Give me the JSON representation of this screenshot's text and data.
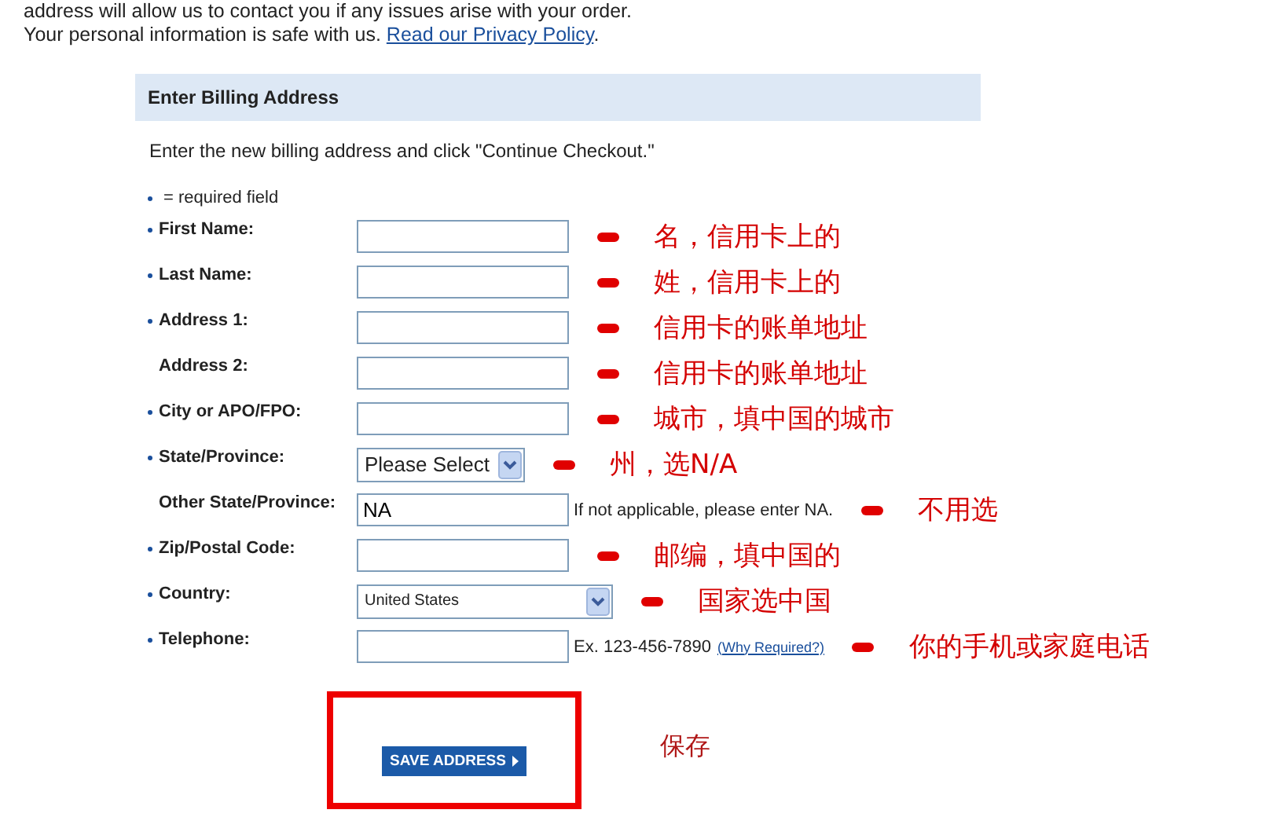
{
  "intro": {
    "line_1": "address will allow us to contact you if any issues arise with your order.",
    "line_2": "Your personal information is safe with us.",
    "privacy_link": "Read our Privacy Policy",
    "line_2_end": "."
  },
  "form": {
    "title": "Enter Billing Address",
    "instructions": "Enter the new billing address and click \"Continue Checkout.\"",
    "required_legend": "= required field",
    "fields": [
      {
        "kind": "text",
        "label": "First Name:",
        "required": true,
        "annotation": "名，信用卡上的"
      },
      {
        "kind": "text",
        "label": "Last Name:",
        "required": true,
        "annotation": "姓，信用卡上的"
      },
      {
        "kind": "text",
        "label": "Address 1:",
        "required": true,
        "annotation": "信用卡的账单地址"
      },
      {
        "kind": "text",
        "label": "Address 2:",
        "required": false,
        "annotation": "信用卡的账单地址"
      },
      {
        "kind": "text",
        "label": "City or APO/FPO:",
        "required": true,
        "annotation": "城市，填中国的城市"
      },
      {
        "kind": "select",
        "label": "State/Province:",
        "required": true,
        "value": "Please Select",
        "annotation": "州，选N/A"
      },
      {
        "kind": "text",
        "label": "Other State/Province:",
        "required": false,
        "value": "NA",
        "hint": "If not applicable, please enter NA.",
        "annotation": "不用选"
      },
      {
        "kind": "text",
        "label": "Zip/Postal Code:",
        "required": true,
        "annotation": "邮编，填中国的"
      },
      {
        "kind": "longselect",
        "label": "Country:",
        "required": true,
        "value": "United States",
        "annotation": "国家选中国"
      },
      {
        "kind": "text",
        "label": "Telephone:",
        "required": true,
        "hint": "Ex. 123-456-7890",
        "link": "(Why Required?)",
        "annotation": "你的手机或家庭电话"
      }
    ],
    "save_button": "SAVE ADDRESS",
    "save_annotation": "保存"
  }
}
